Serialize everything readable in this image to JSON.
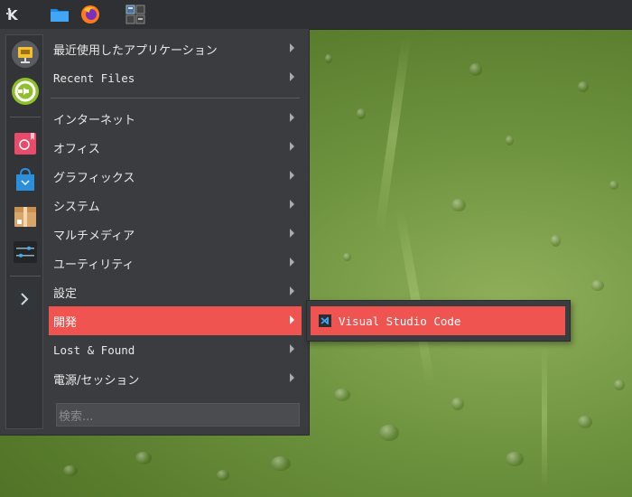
{
  "colors": {
    "panel": "#2f3033",
    "menu_bg": "#3b3c3f",
    "highlight": "#f05450",
    "text": "#e8e8e8"
  },
  "panel": {
    "launcher_icon": "kde-icon",
    "apps": [
      "folder-icon",
      "firefox-icon",
      "pager-icon"
    ]
  },
  "favorites": [
    "presentation-icon",
    "logout-icon",
    "debian-package-icon",
    "discover-store-icon",
    "package-box-icon",
    "system-settings-icon",
    "terminal-icon"
  ],
  "menu": {
    "recent_apps": "最近使用したアプリケーション",
    "recent_files": "Recent Files",
    "internet": "インターネット",
    "office": "オフィス",
    "graphics": "グラフィックス",
    "system": "システム",
    "multimedia": "マルチメディア",
    "utilities": "ユーティリティ",
    "settings": "設定",
    "development": "開発",
    "lost_found": "Lost & Found",
    "power_session": "電源/セッション"
  },
  "search": {
    "placeholder": "検索..."
  },
  "submenu": {
    "vscode": "Visual Studio Code"
  }
}
